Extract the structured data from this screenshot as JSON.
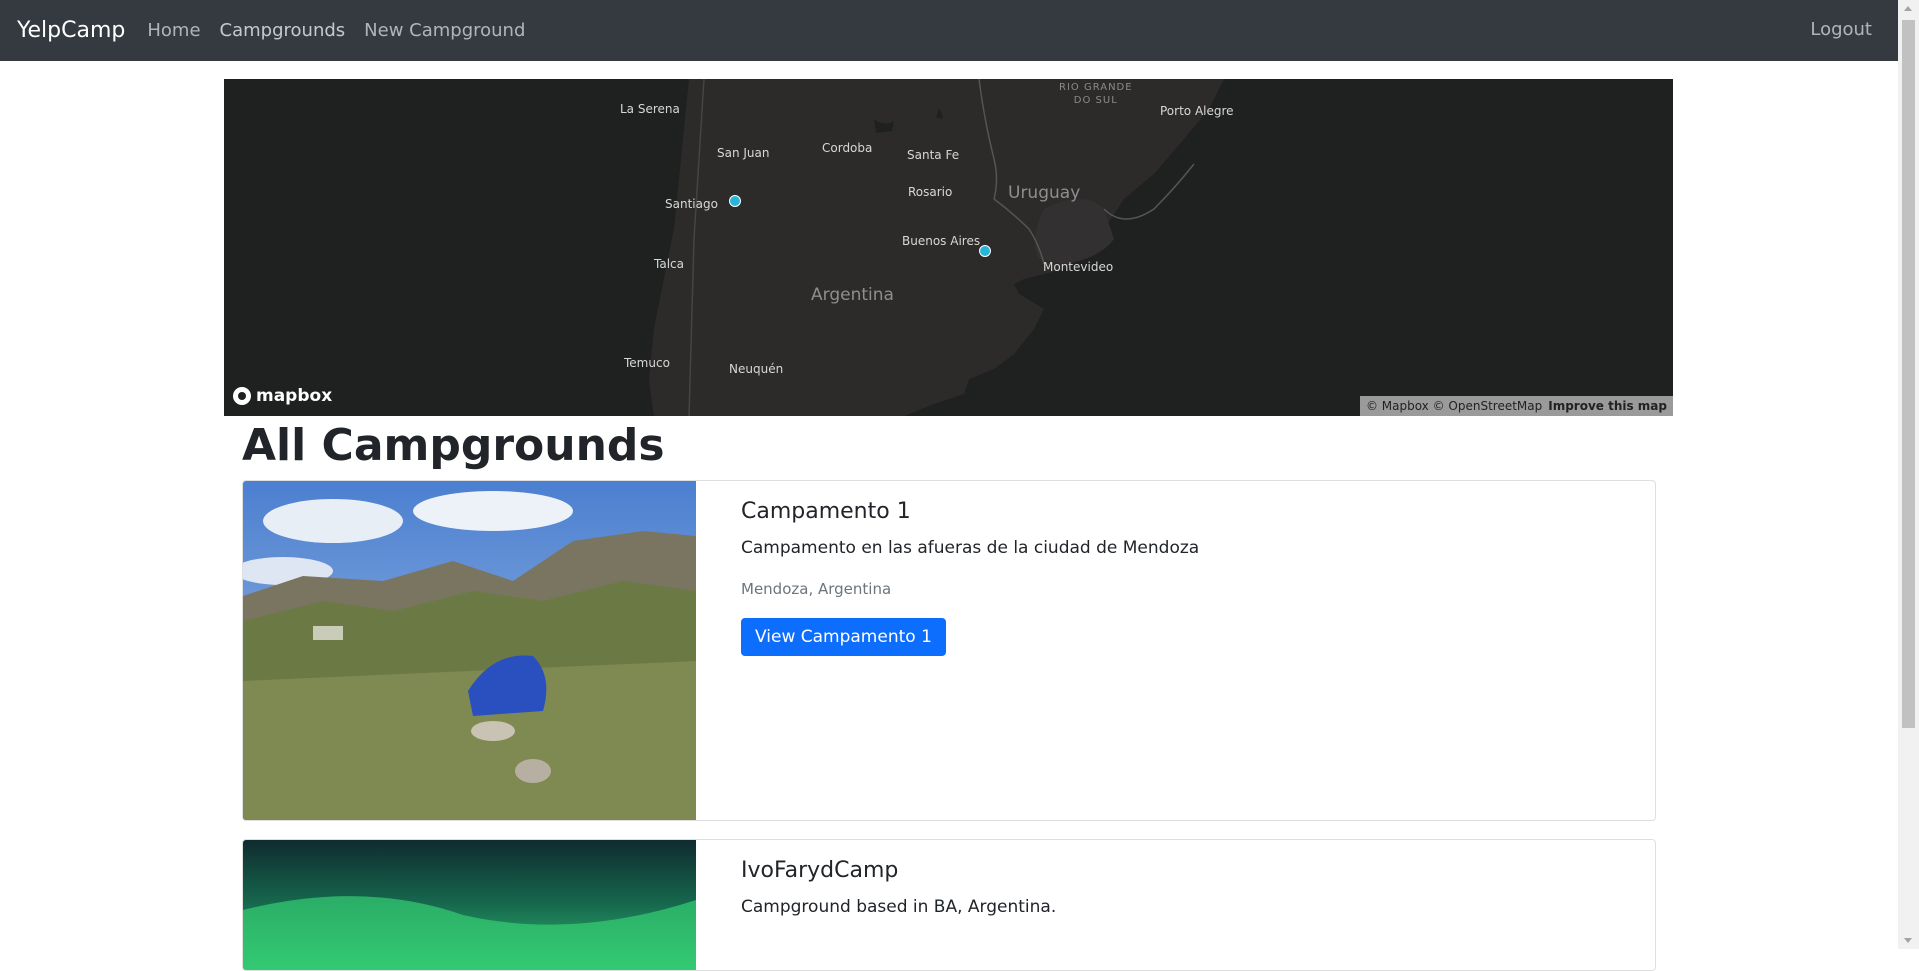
{
  "navbar": {
    "brand": "YelpCamp",
    "links": [
      "Home",
      "Campgrounds",
      "New Campground"
    ],
    "logout": "Logout"
  },
  "map": {
    "labels": {
      "la_serena": "La Serena",
      "san_juan": "San Juan",
      "cordoba": "Cordoba",
      "santa_fe": "Santa Fe",
      "rio_grande": "RIO GRANDE",
      "do_sul": "DO SUL",
      "porto_alegre": "Porto Alegre",
      "santiago": "Santiago",
      "rosario": "Rosario",
      "uruguay": "Uruguay",
      "buenos_aires": "Buenos Aires",
      "montevideo": "Montevideo",
      "talca": "Talca",
      "argentina": "Argentina",
      "temuco": "Temuco",
      "neuquen": "Neuquén"
    },
    "logo": "mapbox",
    "attribution": "© Mapbox © OpenStreetMap",
    "improve": "Improve this map"
  },
  "page_title": "All Campgrounds",
  "campgrounds": [
    {
      "title": "Campamento 1",
      "description": "Campamento en las afueras de la ciudad de Mendoza",
      "location": "Mendoza, Argentina",
      "button": "View Campamento 1"
    },
    {
      "title": "IvoFarydCamp",
      "description": "Campground based in BA, Argentina."
    }
  ],
  "colors": {
    "navbar": "#343a40",
    "primary": "#0d6efd",
    "map_bg": "#1f2121",
    "marker": "#28b5d8"
  }
}
